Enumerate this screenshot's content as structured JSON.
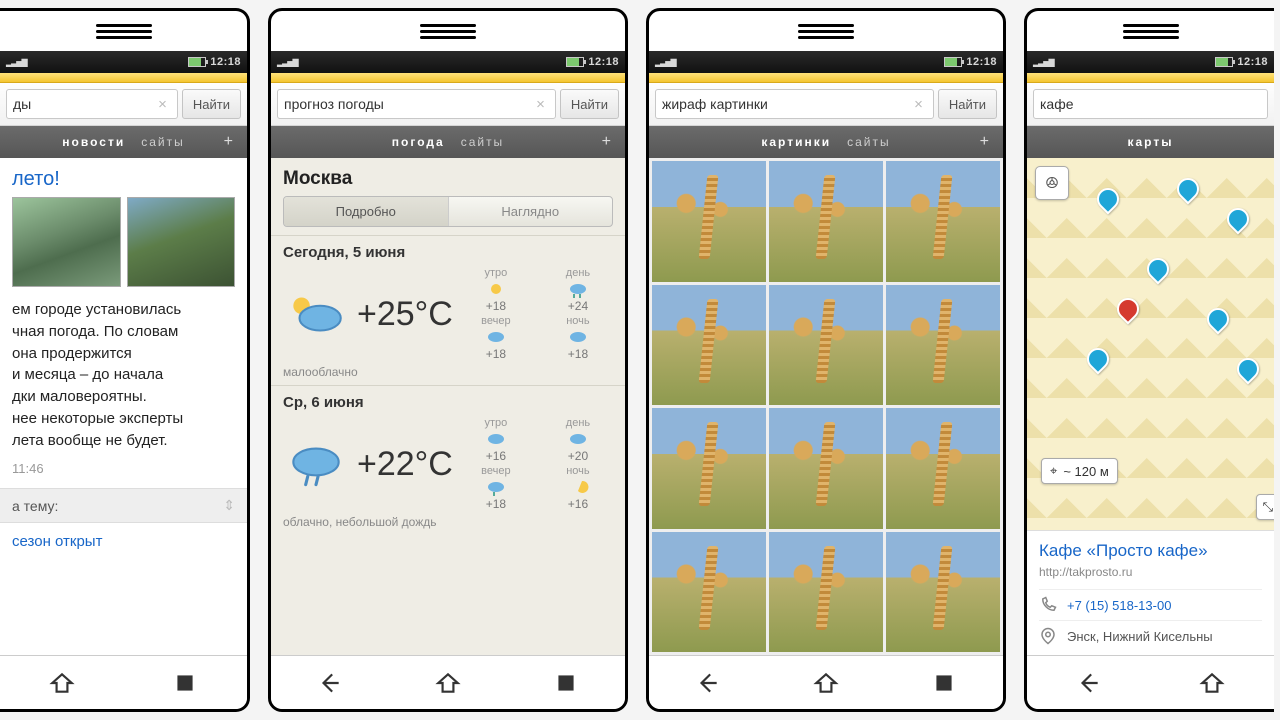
{
  "status_time": "12:18",
  "search_button": "Найти",
  "tab_sites": "сайты",
  "tab_plus": "+",
  "screens": {
    "news": {
      "query": "ды",
      "tab_active": "новости",
      "headline": "лето!",
      "body": "ем городе установилась\nчная погода. По словам\nона продержится\nи месяца – до начала\nдки маловероятны.\nнее некоторые эксперты\nлета вообще не будет.",
      "time": "11:46",
      "related_header": "а тему:",
      "related_item": "сезон открыт"
    },
    "weather": {
      "query": "прогноз погоды",
      "tab_active": "погода",
      "city": "Москва",
      "seg_detail": "Подробно",
      "seg_visual": "Наглядно",
      "days": [
        {
          "date": "Сегодня, 5 июня",
          "temp": "+25°C",
          "desc": "малооблачно",
          "parts": [
            {
              "lbl": "утро",
              "tmp": "+18"
            },
            {
              "lbl": "день",
              "tmp": "+24"
            },
            {
              "lbl": "вечер",
              "tmp": "+18"
            },
            {
              "lbl": "ночь",
              "tmp": "+18"
            }
          ]
        },
        {
          "date": "Ср, 6 июня",
          "temp": "+22°C",
          "desc": "облачно, небольшой дождь",
          "parts": [
            {
              "lbl": "утро",
              "tmp": "+16"
            },
            {
              "lbl": "день",
              "tmp": "+20"
            },
            {
              "lbl": "вечер",
              "tmp": "+18"
            },
            {
              "lbl": "ночь",
              "tmp": "+16"
            }
          ]
        }
      ]
    },
    "images": {
      "query": "жираф картинки",
      "tab_active": "картинки"
    },
    "maps": {
      "query": "кафе",
      "tab_active": "карты",
      "distance": "~ 120 м",
      "poi": {
        "title": "Кафе «Просто кафе»",
        "url": "http://takprosto.ru",
        "phone": "+7 (15) 518-13-00",
        "address": "Энск, Нижний Кисельны"
      }
    }
  }
}
